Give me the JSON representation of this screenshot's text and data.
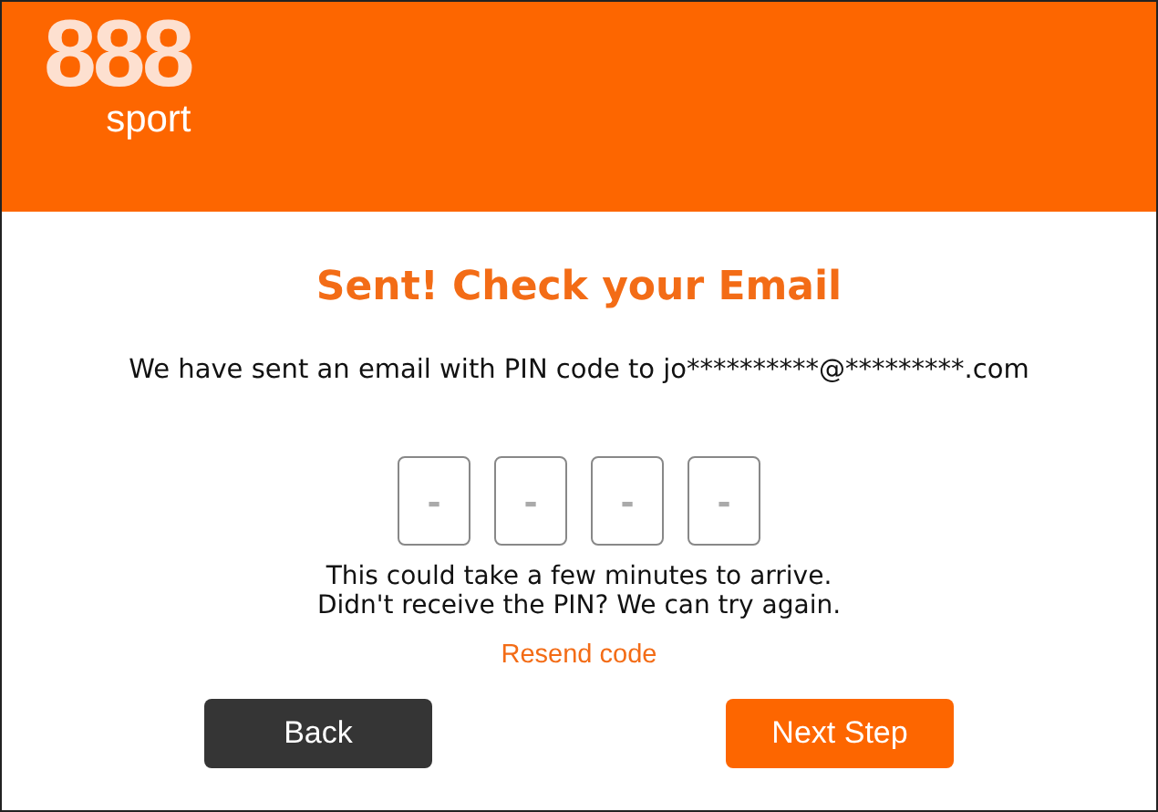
{
  "header": {
    "logo_number": "888",
    "logo_word": "sport"
  },
  "title": "Sent! Check your Email",
  "message": "We have sent an email with PIN code to jo**********@*********.com",
  "pin_fields": [
    {
      "placeholder": "-"
    },
    {
      "placeholder": "-"
    },
    {
      "placeholder": "-"
    },
    {
      "placeholder": "-"
    }
  ],
  "info_lines": [
    "This could take a few minutes to arrive.",
    "Didn't receive the PIN? We can try again."
  ],
  "resend_link": "Resend code",
  "buttons": [
    {
      "label": "Back",
      "kind": "secondary"
    },
    {
      "label": "Next Step",
      "kind": "primary"
    }
  ]
}
